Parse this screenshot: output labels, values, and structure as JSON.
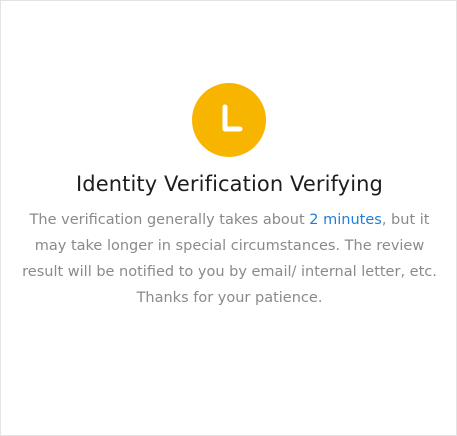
{
  "status": {
    "icon": "clock-icon",
    "icon_color": "#f7b500",
    "title": "Identity Verification Verifying",
    "message_prefix": "The verification generally takes about ",
    "message_highlight": "2 minutes",
    "message_suffix": ", but it may take longer in special circumstances. The review result will be notified to you by email/ internal letter, etc. Thanks for your patience.",
    "highlight_color": "#1f7fd6"
  }
}
